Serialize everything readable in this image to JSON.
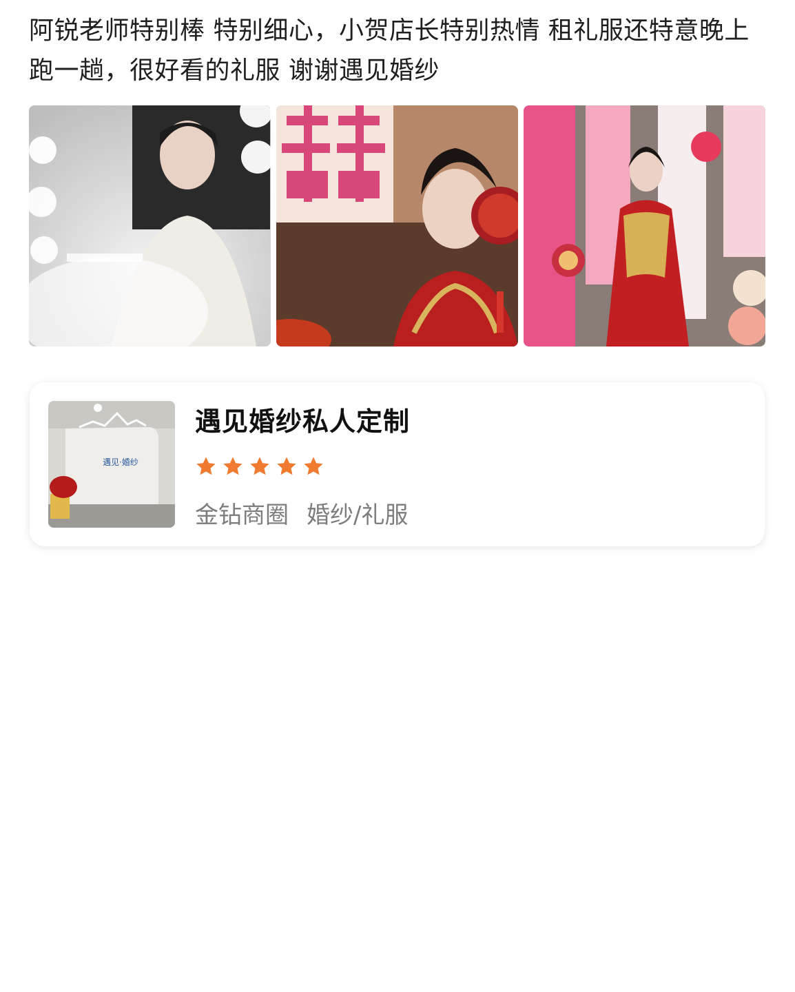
{
  "review": {
    "text": "阿锐老师特别棒 特别细心，小贺店长特别热情 租礼服还特意晚上跑一趟，很好看的礼服 谢谢遇见婚纱"
  },
  "photos": [
    {
      "icon": "photo-bride-white-gown"
    },
    {
      "icon": "photo-bride-red-xiuhe"
    },
    {
      "icon": "photo-bride-red-gown-full"
    }
  ],
  "shop": {
    "name": "遇见婚纱私人定制",
    "rating": 5,
    "rating_max": 5,
    "area": "金钻商圈",
    "category": "婚纱/礼服",
    "thumb_sign": "遇见·婚纱",
    "star_color": "#f07a30"
  }
}
